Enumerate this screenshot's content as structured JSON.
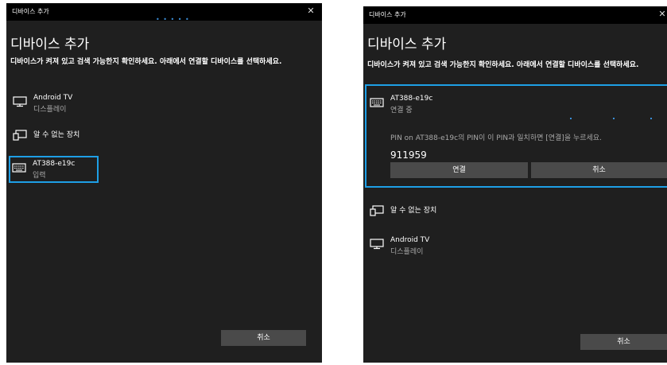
{
  "left": {
    "window_title": "디바이스 추가",
    "close_glyph": "✕",
    "progress": "• • • • •",
    "heading": "디바이스 추가",
    "instruction": "디바이스가 켜져 있고 검색 가능한지 확인하세요. 아래에서 연결할 디바이스를 선택하세요.",
    "devices": [
      {
        "name": "Android TV",
        "status": "디스플레이",
        "icon": "monitor-icon"
      },
      {
        "name": "알 수 없는 장치",
        "status": "",
        "icon": "unknown-device-icon"
      },
      {
        "name": "AT388-e19c",
        "status": "입력",
        "icon": "keyboard-icon"
      }
    ],
    "cancel_label": "취소"
  },
  "right": {
    "window_title": "디바이스 추가",
    "close_glyph": "✕",
    "heading": "디바이스 추가",
    "instruction": "디바이스가 켜져 있고 검색 가능한지 확인하세요. 아래에서 연결할 디바이스를 선택하세요.",
    "pairing": {
      "name": "AT388-e19c",
      "status": "연결 중",
      "icon": "keyboard-icon",
      "message": "PIN on AT388-e19c의 PIN이 이 PIN과 일치하면 [연결]을 누르세요.",
      "pin": "911959",
      "connect_label": "연결",
      "cancel_label": "취소"
    },
    "devices": [
      {
        "name": "알 수 없는 장치",
        "status": "",
        "icon": "unknown-device-icon"
      },
      {
        "name": "Android TV",
        "status": "디스플레이",
        "icon": "monitor-icon"
      }
    ],
    "cancel_label": "취소"
  },
  "colors": {
    "background": "#1f1f1f",
    "titlebar": "#000000",
    "accent": "#1e9fe6",
    "button": "#4a4a4a",
    "secondary_text": "#a8a8a8"
  }
}
